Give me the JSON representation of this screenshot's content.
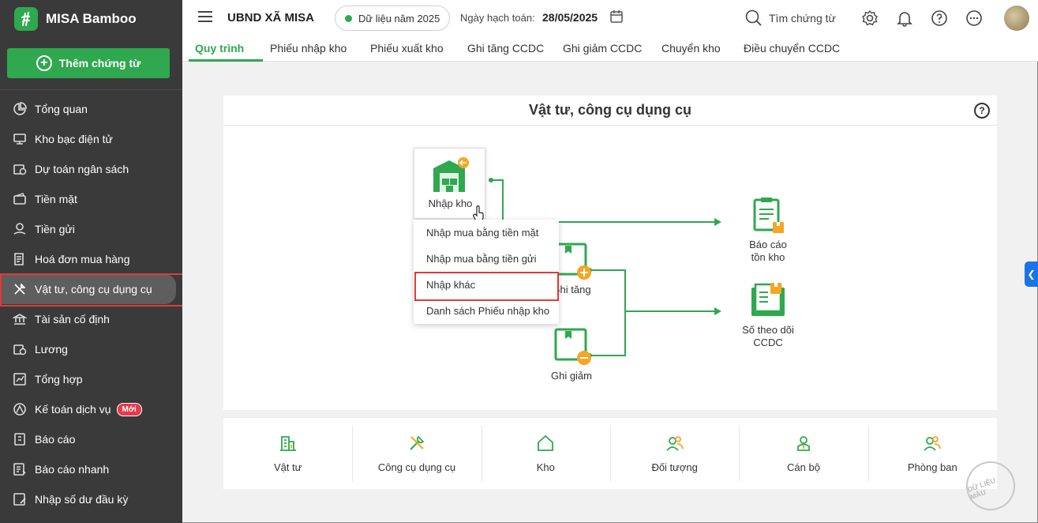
{
  "app": {
    "brand": "MISA Bamboo"
  },
  "sidebar": {
    "add_button": "Thêm chứng từ",
    "items": [
      {
        "label": "Tổng quan",
        "icon": "pie-chart-icon"
      },
      {
        "label": "Kho bạc điện tử",
        "icon": "monitor-icon"
      },
      {
        "label": "Dự toán ngân sách",
        "icon": "budget-icon"
      },
      {
        "label": "Tiền mặt",
        "icon": "wallet-icon"
      },
      {
        "label": "Tiền gửi",
        "icon": "deposit-icon"
      },
      {
        "label": "Hoá đơn mua hàng",
        "icon": "invoice-icon"
      },
      {
        "label": "Vật tư, công cụ dụng cụ",
        "icon": "tools-icon",
        "active": true
      },
      {
        "label": "Tài sản cố định",
        "icon": "bank-icon"
      },
      {
        "label": "Lương",
        "icon": "salary-icon"
      },
      {
        "label": "Tổng hợp",
        "icon": "summary-icon"
      },
      {
        "label": "Kế toán dịch vụ",
        "icon": "service-icon",
        "badge": "Mới"
      },
      {
        "label": "Báo cáo",
        "icon": "report-icon"
      },
      {
        "label": "Báo cáo nhanh",
        "icon": "quick-report-icon"
      },
      {
        "label": "Nhập số dư đầu kỳ",
        "icon": "opening-balance-icon"
      }
    ]
  },
  "header": {
    "org": "UBND XÃ MISA",
    "year": "Dữ liệu năm 2025",
    "date_label": "Ngày hạch toán:",
    "date_value": "28/05/2025",
    "search": "Tìm chứng từ"
  },
  "tabs": [
    "Quy trình",
    "Phiếu nhập kho",
    "Phiếu xuất kho",
    "Ghi tăng CCDC",
    "Ghi giảm CCDC",
    "Chuyển kho",
    "Điều chuyển CCDC"
  ],
  "process": {
    "title": "Vật tư, công cụ dụng cụ",
    "nodes": {
      "nhap_kho": "Nhập kho",
      "ghi_tang": "Ghi tăng",
      "ghi_giam": "Ghi giảm",
      "bao_cao_line1": "Báo cáo",
      "bao_cao_line2": "tồn kho",
      "so_theo_doi_line1": "Số theo dõi",
      "so_theo_doi_line2": "CCDC"
    },
    "dropdown": [
      "Nhập mua bằng tiền mặt",
      "Nhập mua bằng tiền gửi",
      "Nhập khác",
      "Danh sách Phiếu nhập kho"
    ]
  },
  "tiles": [
    "Vật tư",
    "Công cụ dụng cụ",
    "Kho",
    "Đối tượng",
    "Cán bộ",
    "Phòng ban"
  ],
  "watermark": "DỮ LIỆU MẪU",
  "colors": {
    "brand_green": "#2fa84f",
    "sidebar_bg": "#3a3a3a",
    "highlight_red": "#e03a3a",
    "accent_orange": "#f5a623"
  }
}
